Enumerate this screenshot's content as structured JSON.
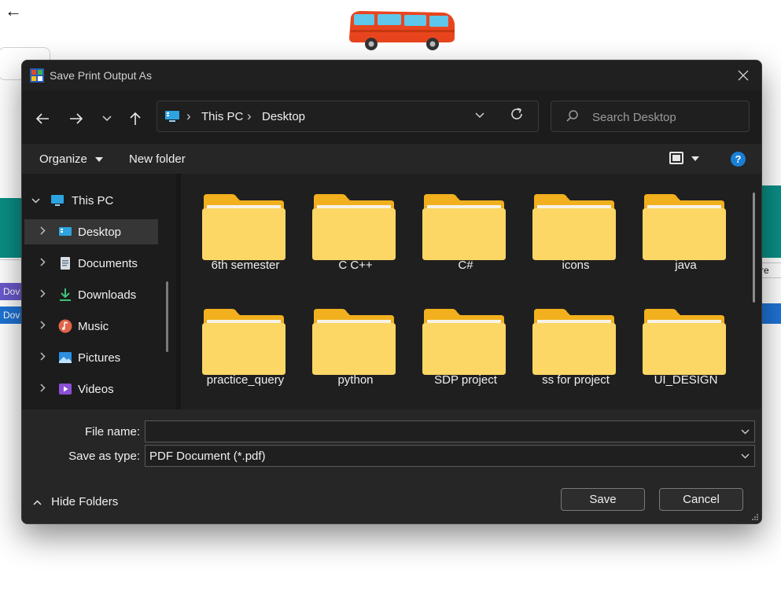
{
  "background": {
    "strip1_text": "Dov",
    "strip2_text": "Dov",
    "right_text": "re"
  },
  "dialog": {
    "title": "Save Print Output As",
    "nav": {
      "back_icon": "arrow-left-icon",
      "forward_icon": "arrow-right-icon",
      "recent_icon": "chevron-down-icon",
      "up_icon": "arrow-up-icon"
    },
    "address": {
      "crumbs": [
        "This PC",
        "Desktop"
      ],
      "separator": "›"
    },
    "search": {
      "placeholder": "Search Desktop"
    },
    "toolbar": {
      "organize": "Organize",
      "new_folder": "New folder",
      "help": "?"
    },
    "sidebar": {
      "items": [
        {
          "label": "This PC",
          "icon": "computer-icon"
        },
        {
          "label": "Desktop",
          "icon": "desktop-icon"
        },
        {
          "label": "Documents",
          "icon": "documents-icon"
        },
        {
          "label": "Downloads",
          "icon": "downloads-icon"
        },
        {
          "label": "Music",
          "icon": "music-icon"
        },
        {
          "label": "Pictures",
          "icon": "pictures-icon"
        },
        {
          "label": "Videos",
          "icon": "videos-icon"
        }
      ]
    },
    "folders": [
      {
        "name": "6th semester"
      },
      {
        "name": "C C++"
      },
      {
        "name": "C#"
      },
      {
        "name": "icons"
      },
      {
        "name": "java"
      },
      {
        "name": "practice_query"
      },
      {
        "name": "python"
      },
      {
        "name": "SDP project"
      },
      {
        "name": "ss for project"
      },
      {
        "name": "UI_DESIGN"
      }
    ],
    "file_name": {
      "label": "File name:",
      "value": ""
    },
    "save_as_type": {
      "label": "Save as type:",
      "value": "PDF Document (*.pdf)"
    },
    "hide_folders": "Hide Folders",
    "buttons": {
      "save": "Save",
      "cancel": "Cancel"
    },
    "colors": {
      "folder_back": "#f2b01e",
      "folder_front": "#fcd765",
      "accent": "#1a7fd6"
    }
  }
}
